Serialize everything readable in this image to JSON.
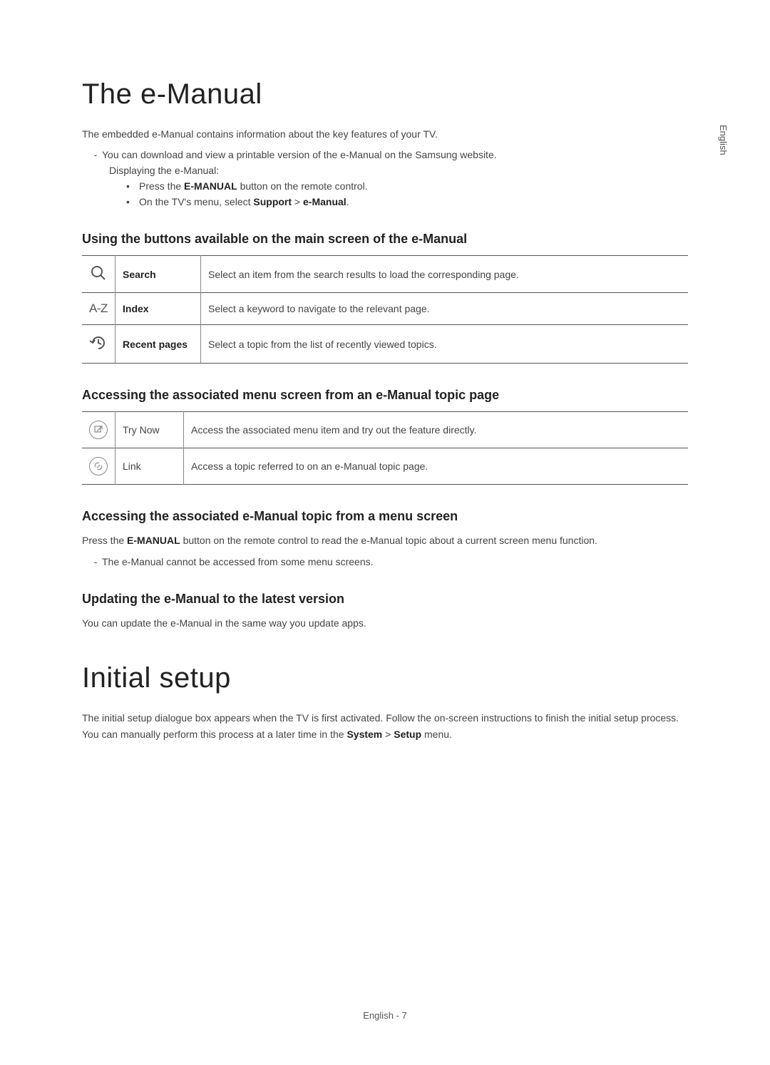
{
  "sideLabel": "English",
  "h1_emanual": "The e-Manual",
  "intro": "The embedded e-Manual contains information about the key features of your TV.",
  "dash1_pre": "You can download and view a printable version of the e-Manual on the Samsung website.",
  "sub_displaying": "Displaying the e-Manual:",
  "bullet1_pre": "Press the ",
  "bullet1_bold": "E-MANUAL",
  "bullet1_post": " button on the remote control.",
  "bullet2_pre": "On the TV's menu, select ",
  "bullet2_b1": "Support",
  "bullet2_sep": " > ",
  "bullet2_b2": "e-Manual",
  "bullet2_post": ".",
  "h3_using": "Using the buttons available on the main screen of the e-Manual",
  "table1": {
    "rows": [
      {
        "label": "Search",
        "desc": "Select an item from the search results to load the corresponding page."
      },
      {
        "label": "Index",
        "desc": "Select a keyword to navigate to the relevant page."
      },
      {
        "label": "Recent pages",
        "desc": "Select a topic from the list of recently viewed topics."
      }
    ],
    "azText": "A-Z"
  },
  "h3_accessing_assoc": "Accessing the associated menu screen from an e-Manual topic page",
  "table2": {
    "rows": [
      {
        "label": "Try Now",
        "desc": "Access the associated menu item and try out the feature directly."
      },
      {
        "label": "Link",
        "desc": "Access a topic referred to on an e-Manual topic page."
      }
    ]
  },
  "h3_accessing_from_menu": "Accessing the associated e-Manual topic from a menu screen",
  "menu_line_pre": "Press the ",
  "menu_line_b": "E-MANUAL",
  "menu_line_post": " button on the remote control to read the e-Manual topic about a current screen menu function.",
  "menu_dash": "The e-Manual cannot be accessed from some menu screens.",
  "h3_updating": "Updating the e-Manual to the latest version",
  "updating_text": "You can update the e-Manual in the same way you update apps.",
  "h1_initial": "Initial setup",
  "initial_pre": "The initial setup dialogue box appears when the TV is first activated. Follow the on-screen instructions to finish the initial setup process. You can manually perform this process at a later time in the ",
  "initial_b1": "System",
  "initial_sep": " > ",
  "initial_b2": "Setup",
  "initial_post": " menu.",
  "pagenum": "English - 7"
}
